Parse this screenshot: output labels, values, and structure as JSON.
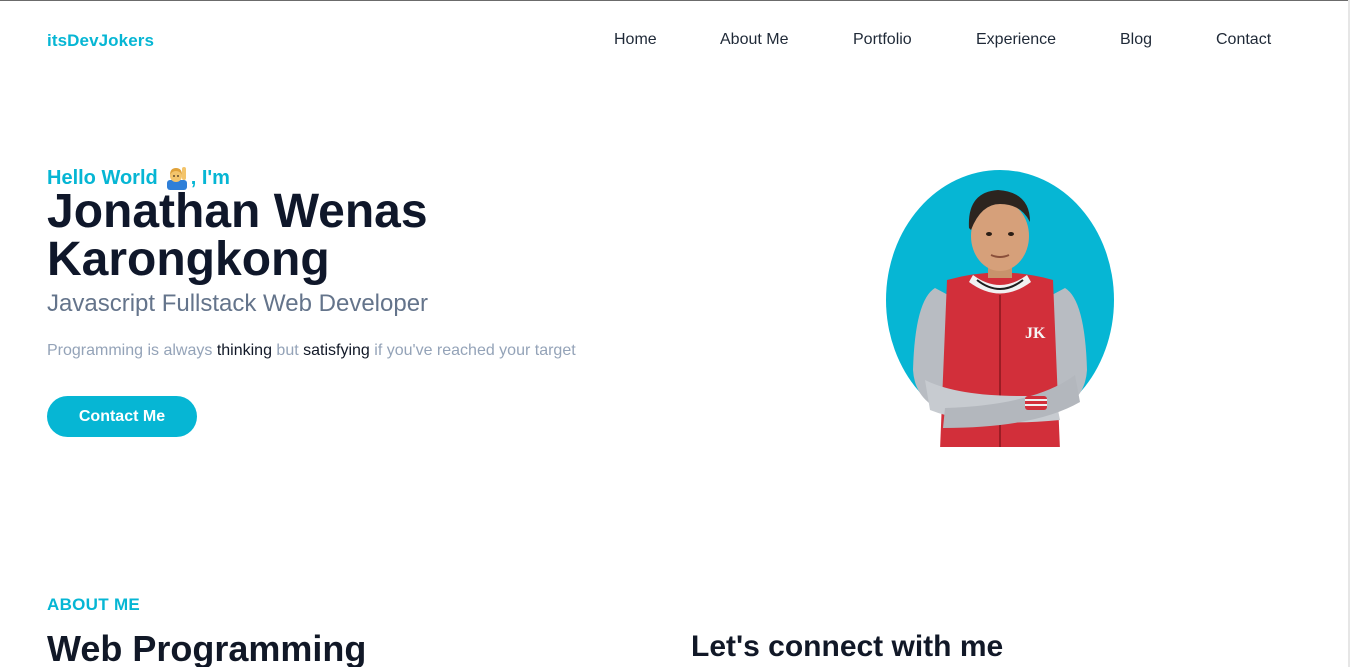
{
  "brand": "itsDevJokers",
  "nav": {
    "home": "Home",
    "about": "About Me",
    "portfolio": "Portfolio",
    "experience": "Experience",
    "blog": "Blog",
    "contact": "Contact"
  },
  "hero": {
    "greeting_prefix": "Hello World",
    "greeting_suffix": ", I'm",
    "greeting_icon": "raising-hand-emoji-icon",
    "name": "Jonathan Wenas Karongkong",
    "role": "Javascript Fullstack Web Developer",
    "quote": {
      "part1": "Programming is always ",
      "word1": "thinking",
      "part2": " but ",
      "word2": "satisfying",
      "part3": " if you've reached your target"
    },
    "cta_label": "Contact Me"
  },
  "about": {
    "label": "ABOUT ME",
    "title": "Web Programming",
    "connect_title": "Let's connect with me"
  },
  "colors": {
    "accent": "#06b6d4",
    "heading": "#0f172a",
    "muted": "#94a3b8",
    "subtitle": "#64748b"
  }
}
